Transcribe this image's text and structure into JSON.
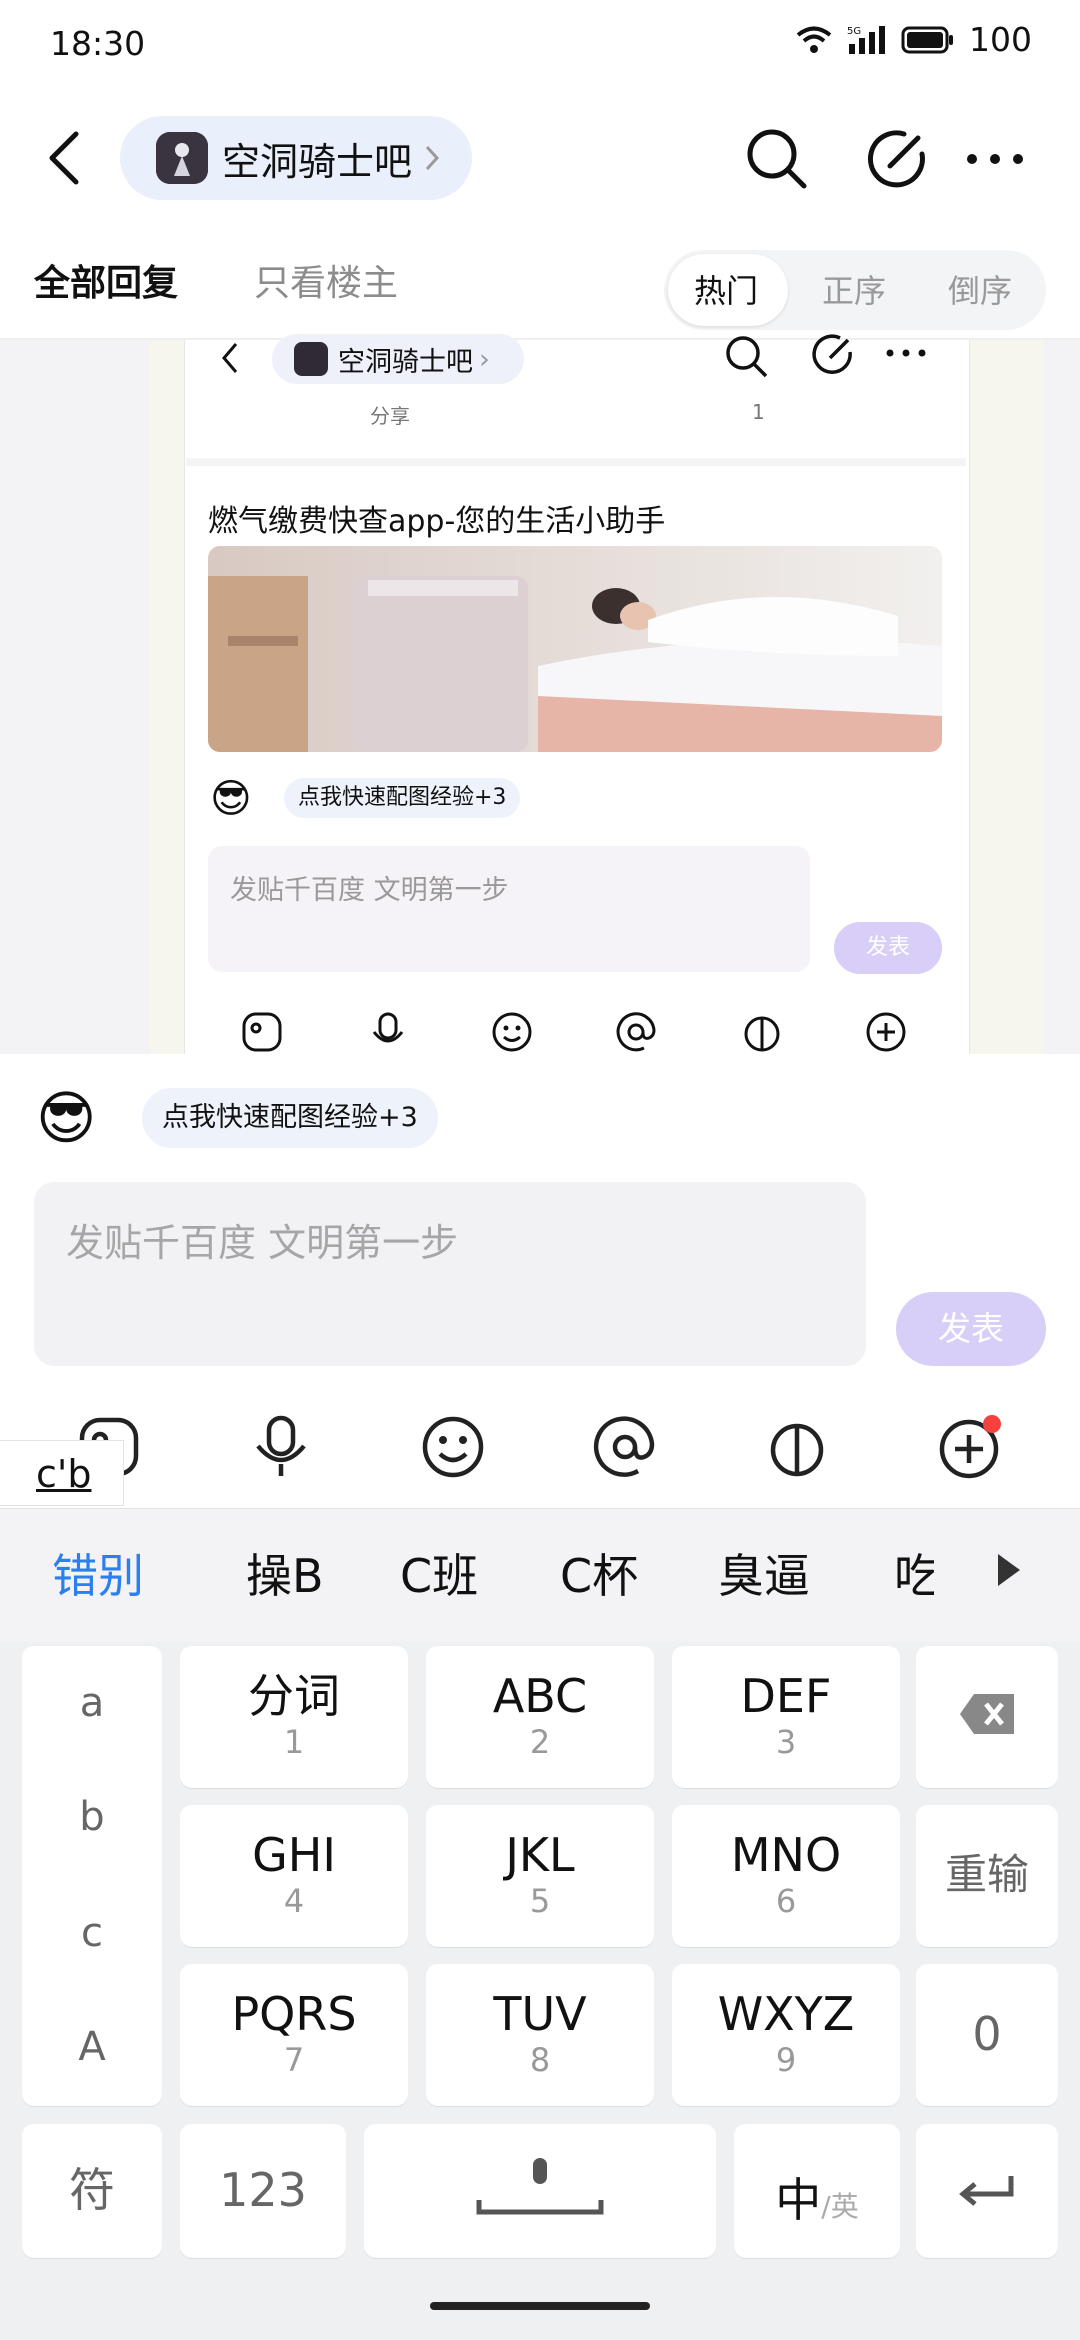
{
  "status": {
    "time": "18:30",
    "battery": "100",
    "network": "5G"
  },
  "header": {
    "forum_name": "空洞骑士吧"
  },
  "tabs": {
    "all_replies": "全部回复",
    "op_only": "只看楼主"
  },
  "sort": {
    "hot": "热门",
    "asc": "正序",
    "desc": "倒序"
  },
  "embedded_screenshot": {
    "forum_name": "空洞骑士吧",
    "share_label": "分享",
    "share_count": "1",
    "ad_title": "燃气缴费快查app-您的生活小助手",
    "hint_bubble": "点我快速配图经验+3",
    "input_placeholder": "发贴千百度 文明第一步",
    "send_label": "发表"
  },
  "composer": {
    "hint_bubble": "点我快速配图经验+3",
    "input_placeholder": "发贴千百度 文明第一步",
    "send_label": "发表",
    "pinyin": "c'b"
  },
  "candidates": [
    "错别",
    "操B",
    "C班",
    "C杯",
    "臭逼",
    "吃"
  ],
  "keyboard": {
    "side_letters": [
      "a",
      "b",
      "c",
      "A"
    ],
    "keys": [
      {
        "main": "分词",
        "sub": "1"
      },
      {
        "main": "ABC",
        "sub": "2"
      },
      {
        "main": "DEF",
        "sub": "3"
      },
      {
        "main": "GHI",
        "sub": "4"
      },
      {
        "main": "JKL",
        "sub": "5"
      },
      {
        "main": "MNO",
        "sub": "6"
      },
      {
        "main": "PQRS",
        "sub": "7"
      },
      {
        "main": "TUV",
        "sub": "8"
      },
      {
        "main": "WXYZ",
        "sub": "9"
      }
    ],
    "reenter": "重输",
    "zero": "0",
    "symbol": "符",
    "num": "123",
    "lang_main": "中",
    "lang_sep": "/",
    "lang_alt": "英"
  },
  "colors": {
    "accent_blue": "#2b7ff0",
    "send_disabled": "#d8cff8",
    "notification_dot": "#f5403d"
  },
  "icons": [
    "back-icon",
    "chevron-right-icon",
    "search-icon",
    "edit-icon",
    "more-icon",
    "sticker-icon",
    "microphone-icon",
    "emoji-icon",
    "at-icon",
    "gift-icon",
    "plus-circle-icon",
    "backspace-icon",
    "enter-icon",
    "candidate-expand-icon"
  ]
}
